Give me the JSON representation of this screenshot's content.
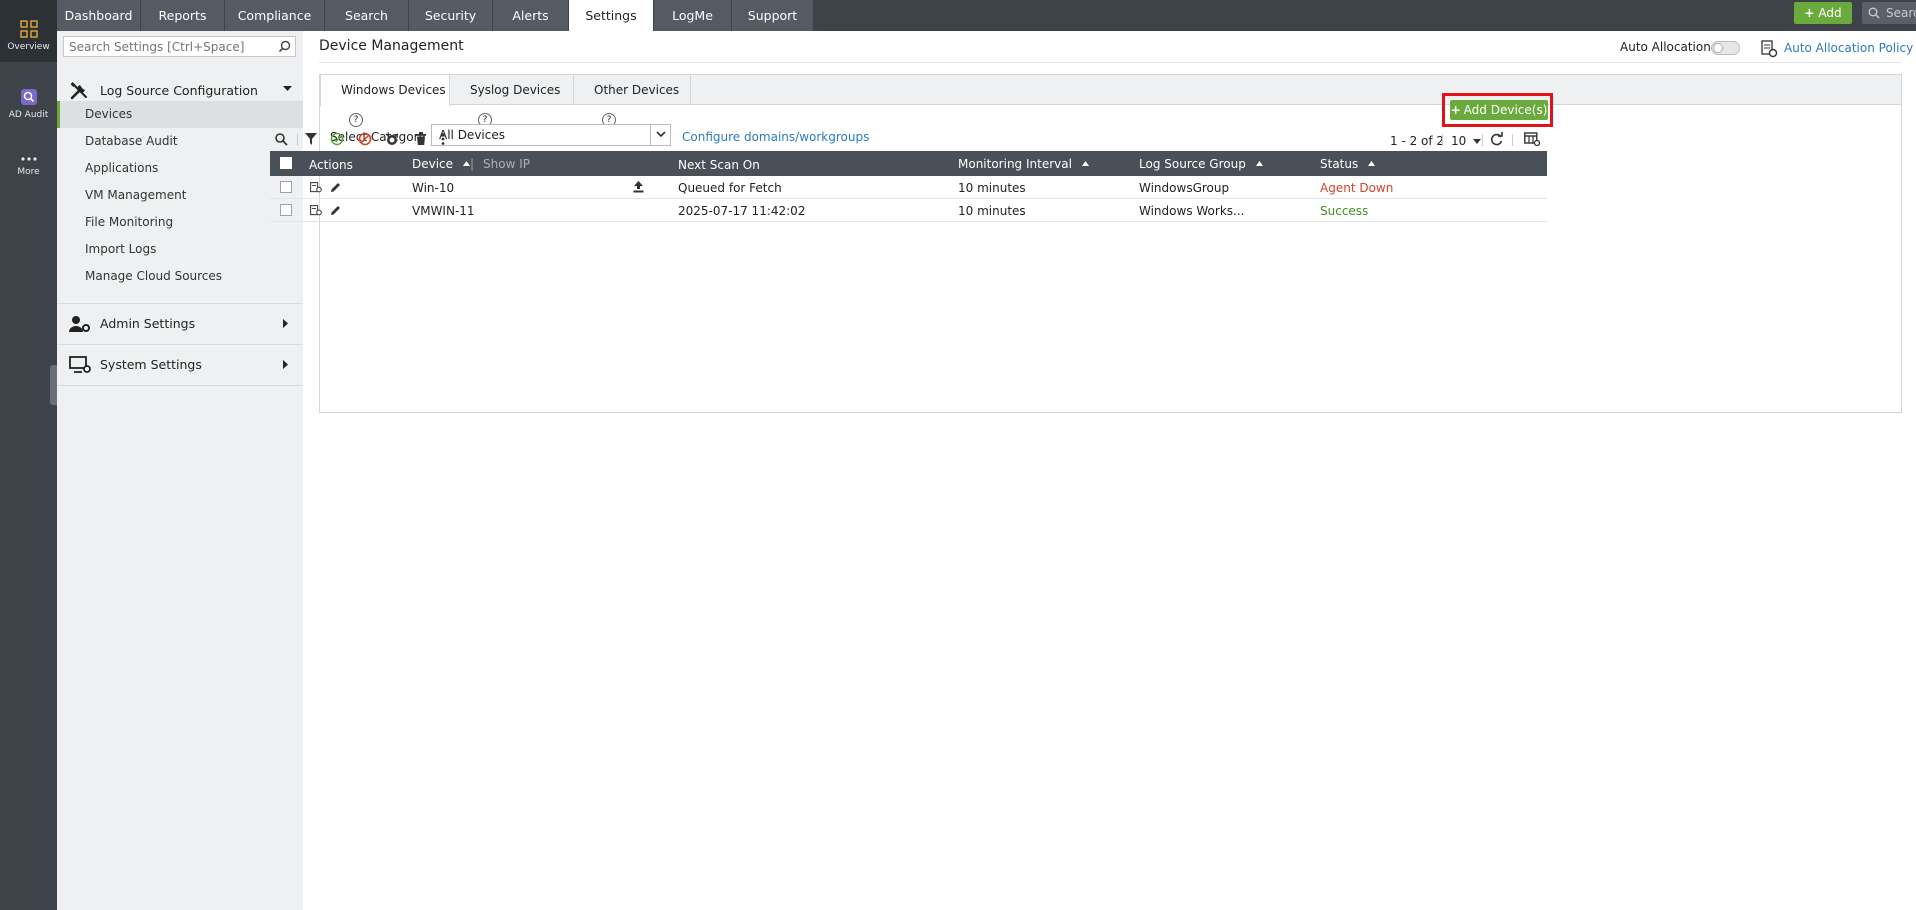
{
  "rail": {
    "items": [
      {
        "label": "Overview",
        "icon": "overview-grid-icon"
      },
      {
        "label": "AD Audit",
        "icon": "ad-audit-icon"
      },
      {
        "label": "More",
        "icon": "more-dots-icon"
      }
    ]
  },
  "topnav": {
    "tabs": [
      "Dashboard",
      "Reports",
      "Compliance",
      "Search",
      "Security",
      "Alerts",
      "Settings",
      "LogMe",
      "Support"
    ],
    "active_tab": "Settings",
    "add_label": "Add",
    "search_placeholder": "Search"
  },
  "sidebar": {
    "search_placeholder": "Search Settings [Ctrl+Space]",
    "sections": [
      {
        "label": "Log Source Configuration",
        "expanded": true,
        "items": [
          "Devices",
          "Database Audit",
          "Applications",
          "VM Management",
          "File Monitoring",
          "Import Logs",
          "Manage Cloud Sources"
        ],
        "active_item": "Devices"
      },
      {
        "label": "Admin Settings",
        "expanded": false
      },
      {
        "label": "System Settings",
        "expanded": false
      }
    ]
  },
  "main": {
    "title": "Device Management",
    "auto_allocation_label": "Auto Allocation",
    "auto_allocation_on": false,
    "auto_allocation_policy_label": "Auto Allocation Policy",
    "tabs": [
      {
        "label": "Windows Devices",
        "help": "?"
      },
      {
        "label": "Syslog Devices",
        "help": "?"
      },
      {
        "label": "Other Devices",
        "help": "?"
      }
    ],
    "active_tab": "Windows Devices",
    "select_category_label": "Select Category",
    "select_category_value": "All Devices",
    "configure_link": "Configure domains/workgroups",
    "add_device_label": "Add Device(s)",
    "pager_text": "1 - 2 of 2",
    "per_page": "10",
    "table": {
      "columns": {
        "actions": "Actions",
        "device": "Device",
        "show_ip": "Show IP",
        "next_scan": "Next Scan On",
        "interval": "Monitoring Interval",
        "group": "Log Source Group",
        "status": "Status"
      },
      "rows": [
        {
          "device": "Win-10",
          "next_scan": "Queued for Fetch",
          "interval": "10 minutes",
          "group": "WindowsGroup",
          "status": "Agent Down"
        },
        {
          "device": "VMWIN-11",
          "next_scan": "2025-07-17 11:42:02",
          "interval": "10 minutes",
          "group": "Windows Works...",
          "status": "Success"
        }
      ]
    }
  },
  "colors": {
    "nav_bg": "#3d4349",
    "accent_green": "#6bab3d",
    "link_blue": "#2a7bbf",
    "status_down": "#d2452a",
    "status_ok": "#3e8f1e",
    "highlight_red": "#e0131b"
  }
}
